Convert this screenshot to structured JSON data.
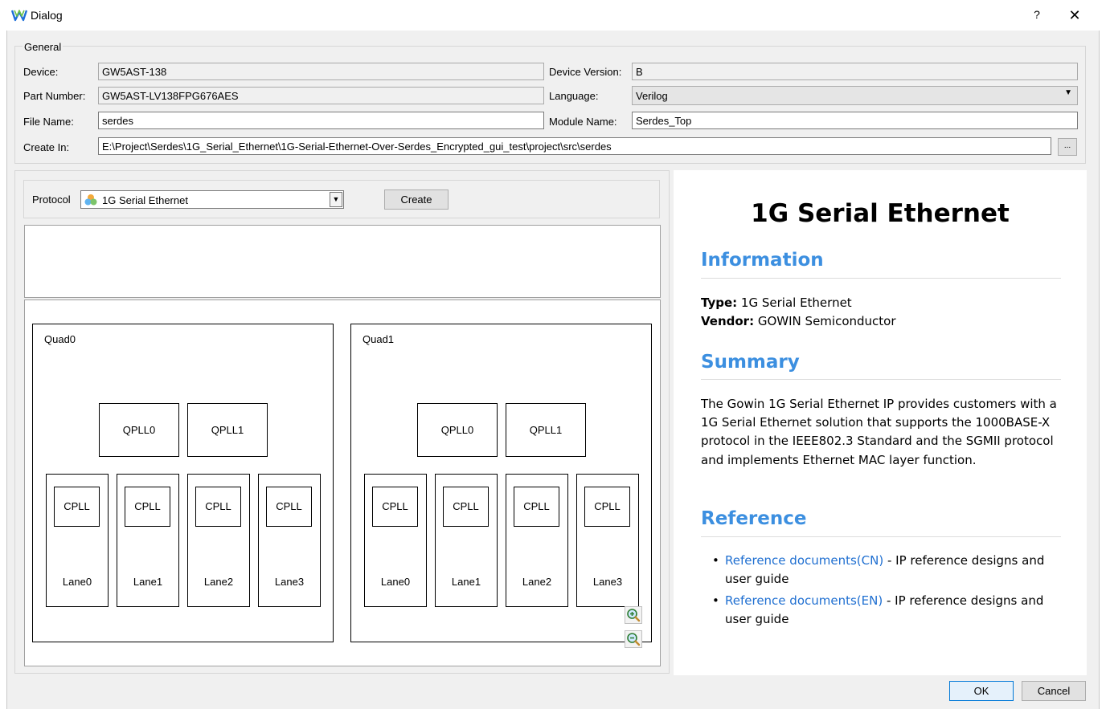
{
  "window": {
    "title": "Dialog",
    "help": "?",
    "close": "✕"
  },
  "general": {
    "title": "General",
    "device_label": "Device:",
    "device_value": "GW5AST-138",
    "device_version_label": "Device Version:",
    "device_version_value": "B",
    "part_number_label": "Part Number:",
    "part_number_value": "GW5AST-LV138FPG676AES",
    "language_label": "Language:",
    "language_value": "Verilog",
    "file_name_label": "File Name:",
    "file_name_value": "serdes",
    "module_name_label": "Module Name:",
    "module_name_value": "Serdes_Top",
    "create_in_label": "Create In:",
    "create_in_value": "E:\\Project\\Serdes\\1G_Serial_Ethernet\\1G-Serial-Ethernet-Over-Serdes_Encrypted_gui_test\\project\\src\\serdes",
    "browse_label": "..."
  },
  "protocol": {
    "label": "Protocol",
    "value": "1G Serial Ethernet",
    "create_label": "Create"
  },
  "diagram": {
    "quads": [
      {
        "title": "Quad0",
        "qplls": [
          "QPLL0",
          "QPLL1"
        ],
        "lanes": [
          {
            "cpll": "CPLL",
            "label": "Lane0"
          },
          {
            "cpll": "CPLL",
            "label": "Lane1"
          },
          {
            "cpll": "CPLL",
            "label": "Lane2"
          },
          {
            "cpll": "CPLL",
            "label": "Lane3"
          }
        ]
      },
      {
        "title": "Quad1",
        "qplls": [
          "QPLL0",
          "QPLL1"
        ],
        "lanes": [
          {
            "cpll": "CPLL",
            "label": "Lane0"
          },
          {
            "cpll": "CPLL",
            "label": "Lane1"
          },
          {
            "cpll": "CPLL",
            "label": "Lane2"
          },
          {
            "cpll": "CPLL",
            "label": "Lane3"
          }
        ]
      }
    ]
  },
  "info": {
    "title": "1G Serial Ethernet",
    "information_heading": "Information",
    "type_label": "Type:",
    "type_value": "1G Serial Ethernet",
    "vendor_label": "Vendor:",
    "vendor_value": "GOWIN Semiconductor",
    "summary_heading": "Summary",
    "summary_text": "The Gowin 1G Serial Ethernet IP provides customers with a 1G Serial Ethernet solution that supports the 1000BASE-X protocol in the IEEE802.3 Standard and the SGMII protocol and implements Ethernet MAC layer function.",
    "reference_heading": "Reference",
    "references": [
      {
        "link": "Reference documents(CN)",
        "text": " - IP reference designs and user guide"
      },
      {
        "link": "Reference documents(EN)",
        "text": " - IP reference designs and user guide"
      }
    ]
  },
  "footer": {
    "ok_label": "OK",
    "cancel_label": "Cancel"
  },
  "colors": {
    "accent": "#3c8fe0",
    "link": "#1f6fd1",
    "ok_border": "#0078d7"
  }
}
